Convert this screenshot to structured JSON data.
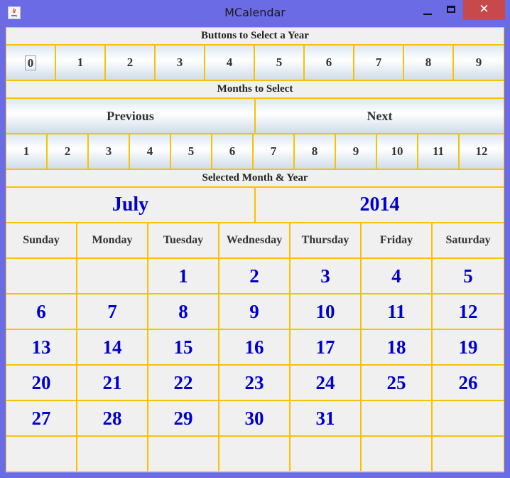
{
  "window": {
    "title": "MCalendar",
    "close_glyph": "✕"
  },
  "labels": {
    "year_buttons": "Buttons to Select a Year",
    "months": "Months to Select",
    "selected": "Selected Month & Year"
  },
  "year_buttons": [
    "0",
    "1",
    "2",
    "3",
    "4",
    "5",
    "6",
    "7",
    "8",
    "9"
  ],
  "nav": {
    "previous": "Previous",
    "next": "Next"
  },
  "month_buttons": [
    "1",
    "2",
    "3",
    "4",
    "5",
    "6",
    "7",
    "8",
    "9",
    "10",
    "11",
    "12"
  ],
  "selected": {
    "month": "July",
    "year": "2014"
  },
  "weekdays": [
    "Sunday",
    "Monday",
    "Tuesday",
    "Wednesday",
    "Thursday",
    "Friday",
    "Saturday"
  ],
  "calendar_weeks": [
    [
      "",
      "",
      "1",
      "2",
      "3",
      "4",
      "5"
    ],
    [
      "6",
      "7",
      "8",
      "9",
      "10",
      "11",
      "12"
    ],
    [
      "13",
      "14",
      "15",
      "16",
      "17",
      "18",
      "19"
    ],
    [
      "20",
      "21",
      "22",
      "23",
      "24",
      "25",
      "26"
    ],
    [
      "27",
      "28",
      "29",
      "30",
      "31",
      "",
      ""
    ],
    [
      "",
      "",
      "",
      "",
      "",
      "",
      ""
    ]
  ],
  "colors": {
    "accent": "#0000cc",
    "grid": "#f8c200",
    "window_frame": "#6b6be6",
    "close": "#c7494b"
  }
}
